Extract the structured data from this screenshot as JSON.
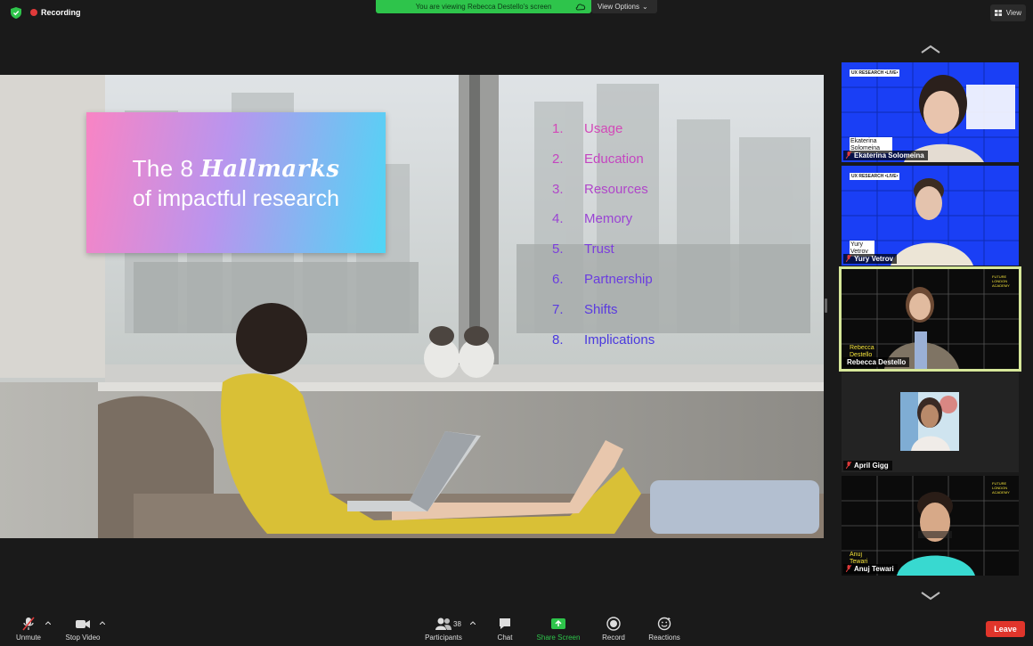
{
  "top": {
    "recording_label": "Recording",
    "viewing_label": "You are viewing Rebecca Destello's screen",
    "view_options_label": "View Options",
    "view_label": "View"
  },
  "slide": {
    "title_line1_prefix": "The 8",
    "title_line1_emph": "Hallmarks",
    "title_line2": "of impactful research",
    "hallmarks": [
      {
        "num": "1.",
        "label": "Usage"
      },
      {
        "num": "2.",
        "label": "Education"
      },
      {
        "num": "3.",
        "label": "Resources"
      },
      {
        "num": "4.",
        "label": "Memory"
      },
      {
        "num": "5.",
        "label": "Trust"
      },
      {
        "num": "6.",
        "label": "Partnership"
      },
      {
        "num": "7.",
        "label": "Shifts"
      },
      {
        "num": "8.",
        "label": "Implications"
      }
    ]
  },
  "gallery": {
    "participants": [
      {
        "name": "Ekaterina Solomeina",
        "overlay": "Ekaterina Solomeina",
        "logo": "UX RESEARCH •LIVE•",
        "muted": true
      },
      {
        "name": "Yury Vetrov",
        "overlay": "Yury Vetrov",
        "logo": "UX RESEARCH •LIVE•",
        "muted": true
      },
      {
        "name": "Rebecca Destello",
        "overlay": "Rebecca Destello",
        "logo": "FUTURE LONDON ACADEMY",
        "muted": false,
        "active": true
      },
      {
        "name": "April Gigg",
        "overlay": "",
        "logo": "",
        "muted": true
      },
      {
        "name": "Anuj Tewari",
        "overlay": "Anuj Tewari",
        "logo": "FUTURE LONDON ACADEMY",
        "muted": true
      }
    ]
  },
  "toolbar": {
    "unmute": "Unmute",
    "stop_video": "Stop Video",
    "participants": "Participants",
    "participant_count": "38",
    "chat": "Chat",
    "share_screen": "Share Screen",
    "record": "Record",
    "reactions": "Reactions",
    "leave": "Leave"
  },
  "colors": {
    "share_green": "#2ec44b",
    "leave_red": "#e0352b",
    "active_speaker": "#d7e89a",
    "tile_blue": "#1a3ff5"
  }
}
